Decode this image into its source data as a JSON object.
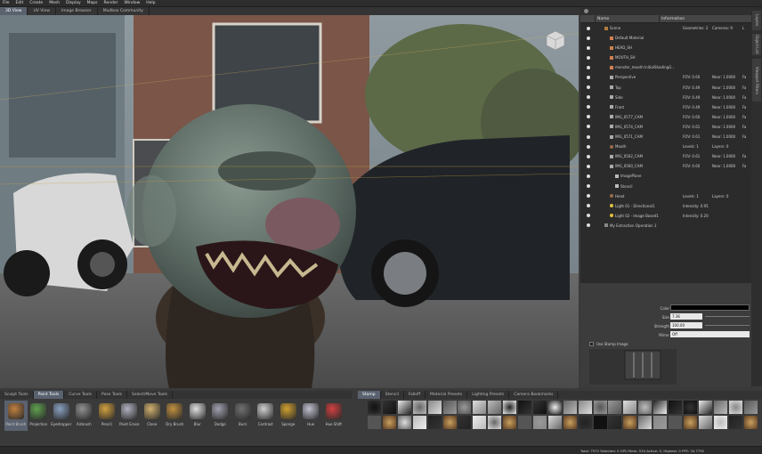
{
  "menu": [
    "File",
    "Edit",
    "Create",
    "Mesh",
    "Display",
    "Maps",
    "Render",
    "Window",
    "Help"
  ],
  "view_tabs": [
    {
      "label": "3D View",
      "active": true
    },
    {
      "label": "UV View"
    },
    {
      "label": "Image Browser"
    },
    {
      "label": "Mudbox Community"
    }
  ],
  "panel": {
    "col_name": "Name",
    "col_info": "Information"
  },
  "tree": [
    {
      "name": "Scene",
      "indent": 0,
      "f1": "Geometries: 2",
      "f2": "Cameras: 9",
      "f3": "L",
      "icon": "scene-icon",
      "color": "#b07a3a"
    },
    {
      "name": "Default Material",
      "indent": 1,
      "icon": "material-icon",
      "color": "#d08050"
    },
    {
      "name": "HEAD_SH",
      "indent": 1,
      "icon": "material-icon",
      "color": "#d08050"
    },
    {
      "name": "MOUTH_SH",
      "indent": 1,
      "icon": "material-icon",
      "color": "#d08050"
    },
    {
      "name": "monster_mouth:initialShadingG...",
      "indent": 1,
      "icon": "material-icon",
      "color": "#d08050"
    },
    {
      "name": "Perspective",
      "indent": 1,
      "f1": "FOV: 0.60",
      "f2": "Near: 1.0000",
      "f3": "Fa",
      "icon": "camera-icon",
      "color": "#aaaaaa"
    },
    {
      "name": "Top",
      "indent": 1,
      "f1": "FOV: 0.49",
      "f2": "Near: 1.0000",
      "f3": "Fa",
      "icon": "camera-icon",
      "color": "#aaaaaa"
    },
    {
      "name": "Side",
      "indent": 1,
      "f1": "FOV: 0.49",
      "f2": "Near: 1.0000",
      "f3": "Fa",
      "icon": "camera-icon",
      "color": "#aaaaaa"
    },
    {
      "name": "Front",
      "indent": 1,
      "f1": "FOV: 0.49",
      "f2": "Near: 1.0000",
      "f3": "Fa",
      "icon": "camera-icon",
      "color": "#aaaaaa"
    },
    {
      "name": "IMG_0577_CAM",
      "indent": 1,
      "f1": "FOV: 0.60",
      "f2": "Near: 1.0000",
      "f3": "Fa",
      "icon": "camera-icon",
      "color": "#aaaaaa"
    },
    {
      "name": "IMG_0574_CAM",
      "indent": 1,
      "f1": "FOV: 0.61",
      "f2": "Near: 1.0000",
      "f3": "Fa",
      "icon": "camera-icon",
      "color": "#aaaaaa"
    },
    {
      "name": "IMG_0571_CAM",
      "indent": 1,
      "f1": "FOV: 0.61",
      "f2": "Near: 1.0000",
      "f3": "Fa",
      "icon": "camera-icon",
      "color": "#aaaaaa"
    },
    {
      "name": "Mouth",
      "indent": 1,
      "f1": "Levels: 1",
      "f2": "Layers: 0",
      "icon": "mesh-icon",
      "color": "#9a6a4a"
    },
    {
      "name": "IMG_0562_CAM",
      "indent": 1,
      "f1": "FOV: 0.61",
      "f2": "Near: 1.0000",
      "f3": "Fa",
      "icon": "camera-icon",
      "color": "#aaaaaa"
    },
    {
      "name": "IMG_0560_CAM",
      "indent": 1,
      "f1": "FOV: 0.60",
      "f2": "Near: 1.0000",
      "f3": "Fa",
      "icon": "camera-icon",
      "color": "#aaaaaa"
    },
    {
      "name": "ImagePlane",
      "indent": 2,
      "icon": "plane-icon",
      "color": "#bbbbbb"
    },
    {
      "name": "Stencil",
      "indent": 2,
      "icon": "plane-icon",
      "color": "#bbbbbb"
    },
    {
      "name": "Head",
      "indent": 1,
      "f1": "Levels: 1",
      "f2": "Layers: 0",
      "icon": "mesh-icon",
      "color": "#9a6a4a"
    },
    {
      "name": "Light 01 - Directional1",
      "indent": 1,
      "f1": "Intensity: 0.95",
      "icon": "light-icon",
      "color": "#e0c040"
    },
    {
      "name": "Light 02 - Image Based1",
      "indent": 1,
      "f1": "Intensity: 0.20",
      "icon": "light-icon",
      "color": "#e0c040"
    },
    {
      "name": "My Extraction Operation 1",
      "indent": 0,
      "icon": "operation-icon",
      "color": "#888888"
    }
  ],
  "props": {
    "color_label": "Color",
    "size_label": "Size",
    "size_value": "7.36",
    "strength_label": "Strength",
    "strength_value": "100.00",
    "mirror_label": "Mirror",
    "mirror_value": "Off",
    "use_stamp": "Use Stamp Image"
  },
  "side_tabs": [
    "Layers",
    "Object List",
    "Viewport Filters"
  ],
  "tool_tabs": [
    {
      "label": "Sculpt Tools"
    },
    {
      "label": "Paint Tools",
      "active": true
    },
    {
      "label": "Curve Tools"
    },
    {
      "label": "Pose Tools"
    },
    {
      "label": "Select/Move Tools"
    }
  ],
  "tools": [
    {
      "label": "Paint Brush",
      "icon": "paint-brush-icon",
      "color": "#c08040",
      "active": true
    },
    {
      "label": "Projection",
      "icon": "projection-icon",
      "color": "#60a050"
    },
    {
      "label": "Eyedropper",
      "icon": "eyedropper-icon",
      "color": "#8aa0c0"
    },
    {
      "label": "Airbrush",
      "icon": "airbrush-icon",
      "color": "#909090"
    },
    {
      "label": "Pencil",
      "icon": "pencil-icon",
      "color": "#d0a040"
    },
    {
      "label": "Paint Erase",
      "icon": "eraser-icon",
      "color": "#b0b0c0"
    },
    {
      "label": "Clone",
      "icon": "clone-icon",
      "color": "#d0b070"
    },
    {
      "label": "Dry Brush",
      "icon": "dry-brush-icon",
      "color": "#c09040"
    },
    {
      "label": "Blur",
      "icon": "blur-icon",
      "color": "#e0e0e0"
    },
    {
      "label": "Dodge",
      "icon": "dodge-icon",
      "color": "#a0a0b0"
    },
    {
      "label": "Burn",
      "icon": "burn-icon",
      "color": "#707070"
    },
    {
      "label": "Contrast",
      "icon": "contrast-icon",
      "color": "#d0d0d0"
    },
    {
      "label": "Sponge",
      "icon": "sponge-icon",
      "color": "#d0a030"
    },
    {
      "label": "Hue",
      "icon": "hue-icon",
      "color": "#c0c0d0"
    },
    {
      "label": "Hue Shift",
      "icon": "hue-shift-icon",
      "color": "#d04040"
    }
  ],
  "stamp_tabs": [
    {
      "label": "Stamp",
      "active": true
    },
    {
      "label": "Stencil"
    },
    {
      "label": "Falloff"
    },
    {
      "label": "Material Presets"
    },
    {
      "label": "Lighting Presets"
    },
    {
      "label": "Camera Bookmarks"
    }
  ],
  "status": "Total: 7572  Selected: 0  GPU Mem: 534  Active: 0, Highest: 0  FPS: 34.7792"
}
